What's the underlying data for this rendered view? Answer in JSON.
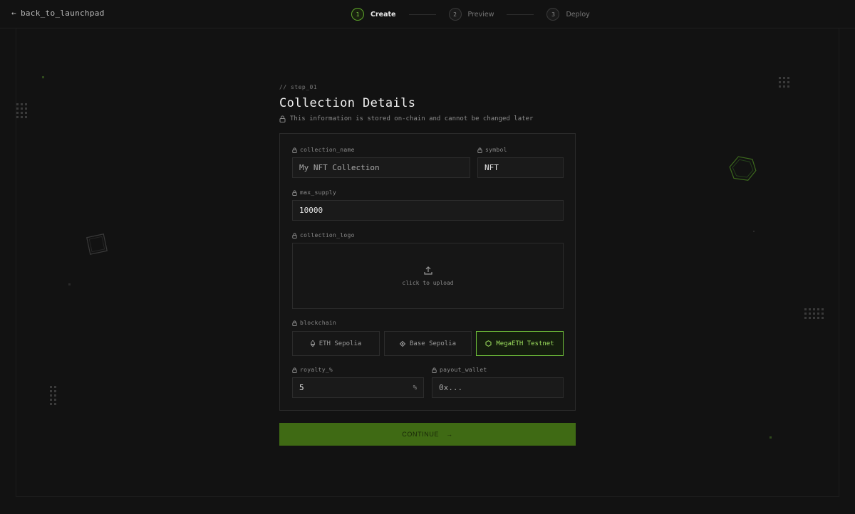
{
  "nav": {
    "back_label": "back_to_launchpad",
    "back_arrow": "←",
    "steps": [
      {
        "num": "1",
        "label": "Create",
        "active": true
      },
      {
        "num": "2",
        "label": "Preview",
        "active": false
      },
      {
        "num": "3",
        "label": "Deploy",
        "active": false
      }
    ]
  },
  "header": {
    "step_tag": "// step_01",
    "title": "Collection Details",
    "notice": "This information is stored on-chain and cannot be changed later"
  },
  "form": {
    "collection_name": {
      "label": "collection_name",
      "value": "My NFT Collection"
    },
    "symbol": {
      "label": "symbol",
      "value": "NFT"
    },
    "max_supply": {
      "label": "max_supply",
      "value": "10000"
    },
    "collection_logo": {
      "label": "collection_logo",
      "upload_text": "click to upload"
    },
    "blockchain": {
      "label": "blockchain",
      "options": [
        {
          "label": "ETH Sepolia",
          "icon": "eth-icon",
          "selected": false
        },
        {
          "label": "Base Sepolia",
          "icon": "diamond-icon",
          "selected": false
        },
        {
          "label": "MegaETH Testnet",
          "icon": "hexagon-icon",
          "selected": true
        }
      ]
    },
    "royalty": {
      "label": "royalty_%",
      "value": "5",
      "suffix": "%"
    },
    "payout_wallet": {
      "label": "payout_wallet",
      "placeholder": "0x..."
    }
  },
  "actions": {
    "continue_label": "CONTINUE",
    "continue_arrow": "→"
  },
  "colors": {
    "background": "#121212",
    "accent": "#6fbf3a",
    "button": "#3f6a14"
  }
}
